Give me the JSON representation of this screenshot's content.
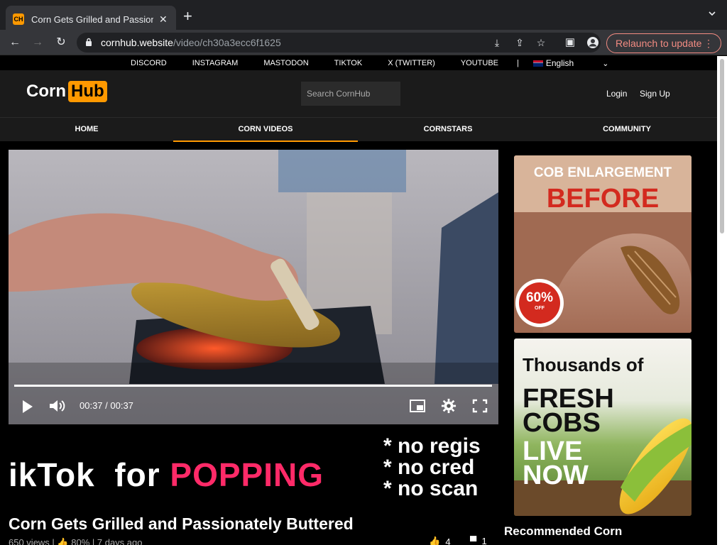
{
  "browser": {
    "tab_title": "Corn Gets Grilled and Passiona",
    "favicon_text": "CH",
    "url_domain": "cornhub.website",
    "url_path": "/video/ch30a3ecc6f1625",
    "relaunch_label": "Relaunch to update"
  },
  "social_links": [
    "DISCORD",
    "INSTAGRAM",
    "MASTODON",
    "TIKTOK",
    "X (TWITTER)",
    "YOUTUBE"
  ],
  "separator": "|",
  "language": "English",
  "logo": {
    "part1": "Corn",
    "part2": "Hub"
  },
  "search": {
    "placeholder": "Search CornHub"
  },
  "auth": {
    "login": "Login",
    "signup": "Sign Up"
  },
  "nav": [
    {
      "label": "HOME",
      "active": false
    },
    {
      "label": "CORN VIDEOS",
      "active": true
    },
    {
      "label": "CORNSTARS",
      "active": false
    },
    {
      "label": "COMMUNITY",
      "active": false
    }
  ],
  "player": {
    "time": "00:37 / 00:37",
    "progress": 1.0
  },
  "banner": {
    "brand": "ikTok",
    "for": "for",
    "popping": "POPPING",
    "lines": [
      "* no regis",
      "* no cred",
      "* no scan"
    ]
  },
  "video": {
    "title": "Corn Gets Grilled and Passionately Buttered",
    "views": "650 views",
    "rating": "80%",
    "age": "7 days ago",
    "likes": "4",
    "comments": "1"
  },
  "ads": {
    "ad1": {
      "headline": "COB ENLARGEMENT",
      "sub": "BEFORE",
      "discount": "60%",
      "discount_label": "OFF"
    },
    "ad2": {
      "top": "Thousands of",
      "lines": [
        "FRESH",
        "COBS",
        "LIVE",
        "NOW"
      ]
    }
  },
  "sidebar": {
    "heading": "Recommended Corn"
  },
  "colors": {
    "accent": "#ff9900",
    "pink": "#ff2a68",
    "ad_red": "#d32a1f"
  }
}
